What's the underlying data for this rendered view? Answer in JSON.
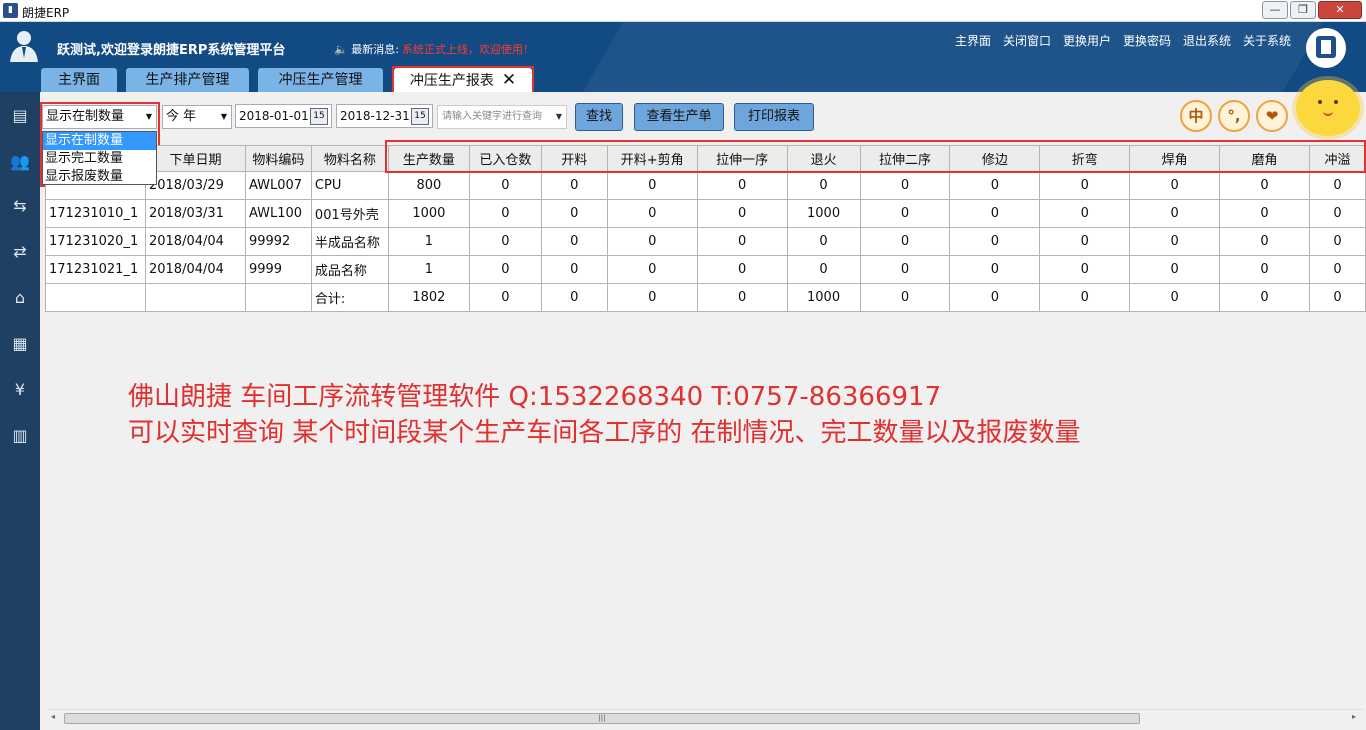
{
  "window": {
    "title": "朗捷ERP",
    "minimize": "—",
    "restore": "❐",
    "close": "✕"
  },
  "header": {
    "welcome": "跃测试,欢迎登录朗捷ERP系统管理平台",
    "news_label": "🔈 最新消息:",
    "news_text": "系统正式上线，欢迎使用！",
    "links": [
      "主界面",
      "关闭窗口",
      "更换用户",
      "更换密码",
      "退出系统",
      "关于系统"
    ]
  },
  "tabs": [
    {
      "label": "主界面"
    },
    {
      "label": "生产排产管理"
    },
    {
      "label": "冲压生产管理"
    },
    {
      "label": "冲压生产报表",
      "close": "✕"
    }
  ],
  "sidebar": {
    "icons": [
      "document-icon",
      "users-icon",
      "truck-out-icon",
      "truck-in-icon",
      "home-icon",
      "factory-icon",
      "money-icon",
      "clipboard-icon"
    ]
  },
  "toolbar": {
    "mode_select": "显示在制数量",
    "mode_options": [
      "显示在制数量",
      "显示完工数量",
      "显示报废数量"
    ],
    "period_select": "今 年",
    "date_from": "2018-01-01",
    "date_to": "2018-12-31",
    "calendar_glyph": "15",
    "search_placeholder": "请输入关键字进行查询",
    "btn_search": "查找",
    "btn_view_order": "查看生产单",
    "btn_print": "打印报表",
    "round_buttons": [
      "中",
      "°,",
      "❤"
    ]
  },
  "table": {
    "headers": [
      "下单日期",
      "物料编码",
      "物料名称",
      "生产数量",
      "已入仓数",
      "开料",
      "开料+剪角",
      "拉伸一序",
      "退火",
      "拉伸二序",
      "修边",
      "折弯",
      "焊角",
      "磨角",
      "冲溢"
    ],
    "rows": [
      [
        "",
        "2018/03/29",
        "AWL007",
        "CPU",
        "800",
        "0",
        "0",
        "0",
        "0",
        "0",
        "0",
        "0",
        "0",
        "0",
        "0",
        "0"
      ],
      [
        "171231010_1",
        "2018/03/31",
        "AWL100",
        "001号外壳",
        "1000",
        "0",
        "0",
        "0",
        "0",
        "1000",
        "0",
        "0",
        "0",
        "0",
        "0",
        "0"
      ],
      [
        "171231020_1",
        "2018/04/04",
        "99992",
        "半成品名称",
        "1",
        "0",
        "0",
        "0",
        "0",
        "0",
        "0",
        "0",
        "0",
        "0",
        "0",
        "0"
      ],
      [
        "171231021_1",
        "2018/04/04",
        "9999",
        "成品名称",
        "1",
        "0",
        "0",
        "0",
        "0",
        "0",
        "0",
        "0",
        "0",
        "0",
        "0",
        "0"
      ],
      [
        "",
        "",
        "",
        "合计:",
        "1802",
        "0",
        "0",
        "0",
        "0",
        "1000",
        "0",
        "0",
        "0",
        "0",
        "0",
        "0"
      ]
    ]
  },
  "notes": {
    "line1": "佛山朗捷 车间工序流转管理软件   Q:1532268340 T:0757-86366917",
    "line2": "可以实时查询 某个时间段某个生产车间各工序的 在制情况、完工数量以及报废数量"
  },
  "scrollbar": {
    "left_arrow": "◂",
    "right_arrow": "▸",
    "grip": "|||"
  },
  "colors": {
    "header_bg": "#124a84",
    "sidebar_bg": "#1f3f63",
    "tab_bg": "#7ab3e6",
    "highlight": "#e23232",
    "note": "#e03030"
  }
}
